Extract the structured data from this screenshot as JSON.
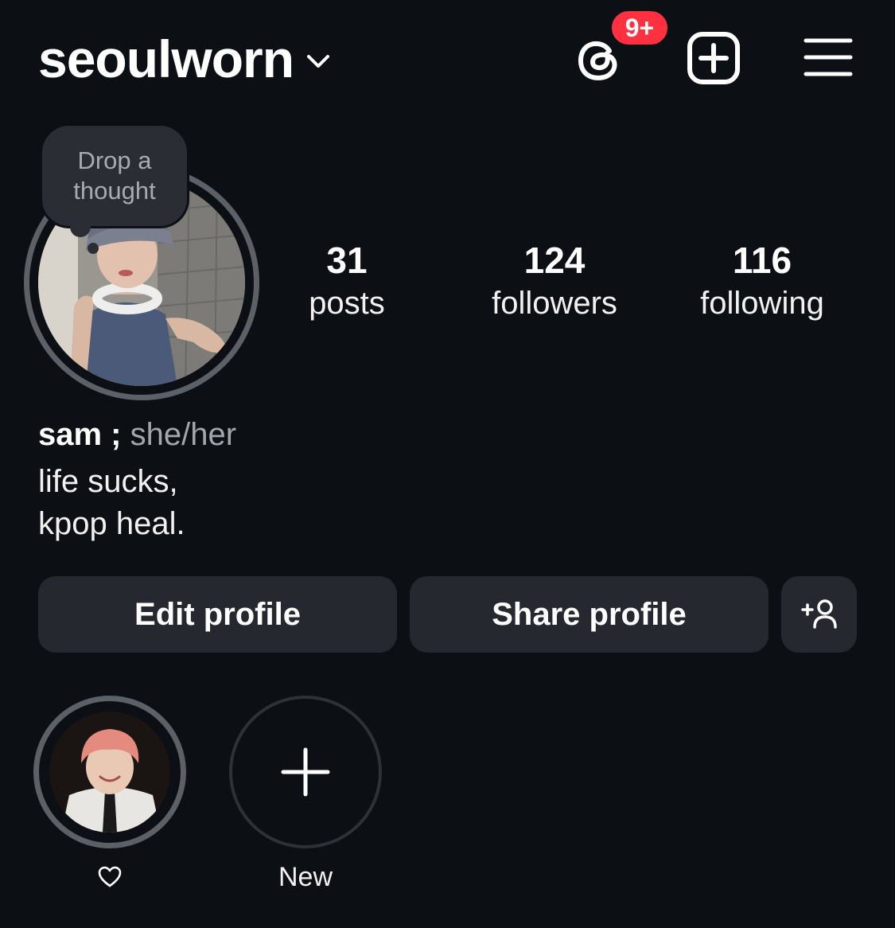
{
  "header": {
    "username": "seoulworn",
    "notification_badge": "9+",
    "icons": {
      "account_switcher": "chevron-down-icon",
      "threads": "threads-icon",
      "new_post": "plus-square-icon",
      "menu": "hamburger-menu-icon"
    },
    "badge_color": "#ff3040"
  },
  "profile": {
    "thought_prompt": "Drop a thought",
    "stats": {
      "posts": {
        "count": "31",
        "label": "posts"
      },
      "followers": {
        "count": "124",
        "label": "followers"
      },
      "following": {
        "count": "116",
        "label": "following"
      }
    },
    "display_name": "sam ;",
    "pronouns": "she/her",
    "bio_lines": [
      "life sucks,",
      "kpop heal."
    ]
  },
  "actions": {
    "edit_label": "Edit profile",
    "share_label": "Share profile",
    "discover_icon": "add-person-icon"
  },
  "highlights": [
    {
      "label_icon": "heart-outline-icon",
      "label": ""
    },
    {
      "label": "New",
      "icon": "plus-icon"
    }
  ],
  "colors": {
    "background": "#0c0f14",
    "button_bg": "#25282e",
    "ring": "#5c6168",
    "muted_text": "#a3a6ac"
  }
}
